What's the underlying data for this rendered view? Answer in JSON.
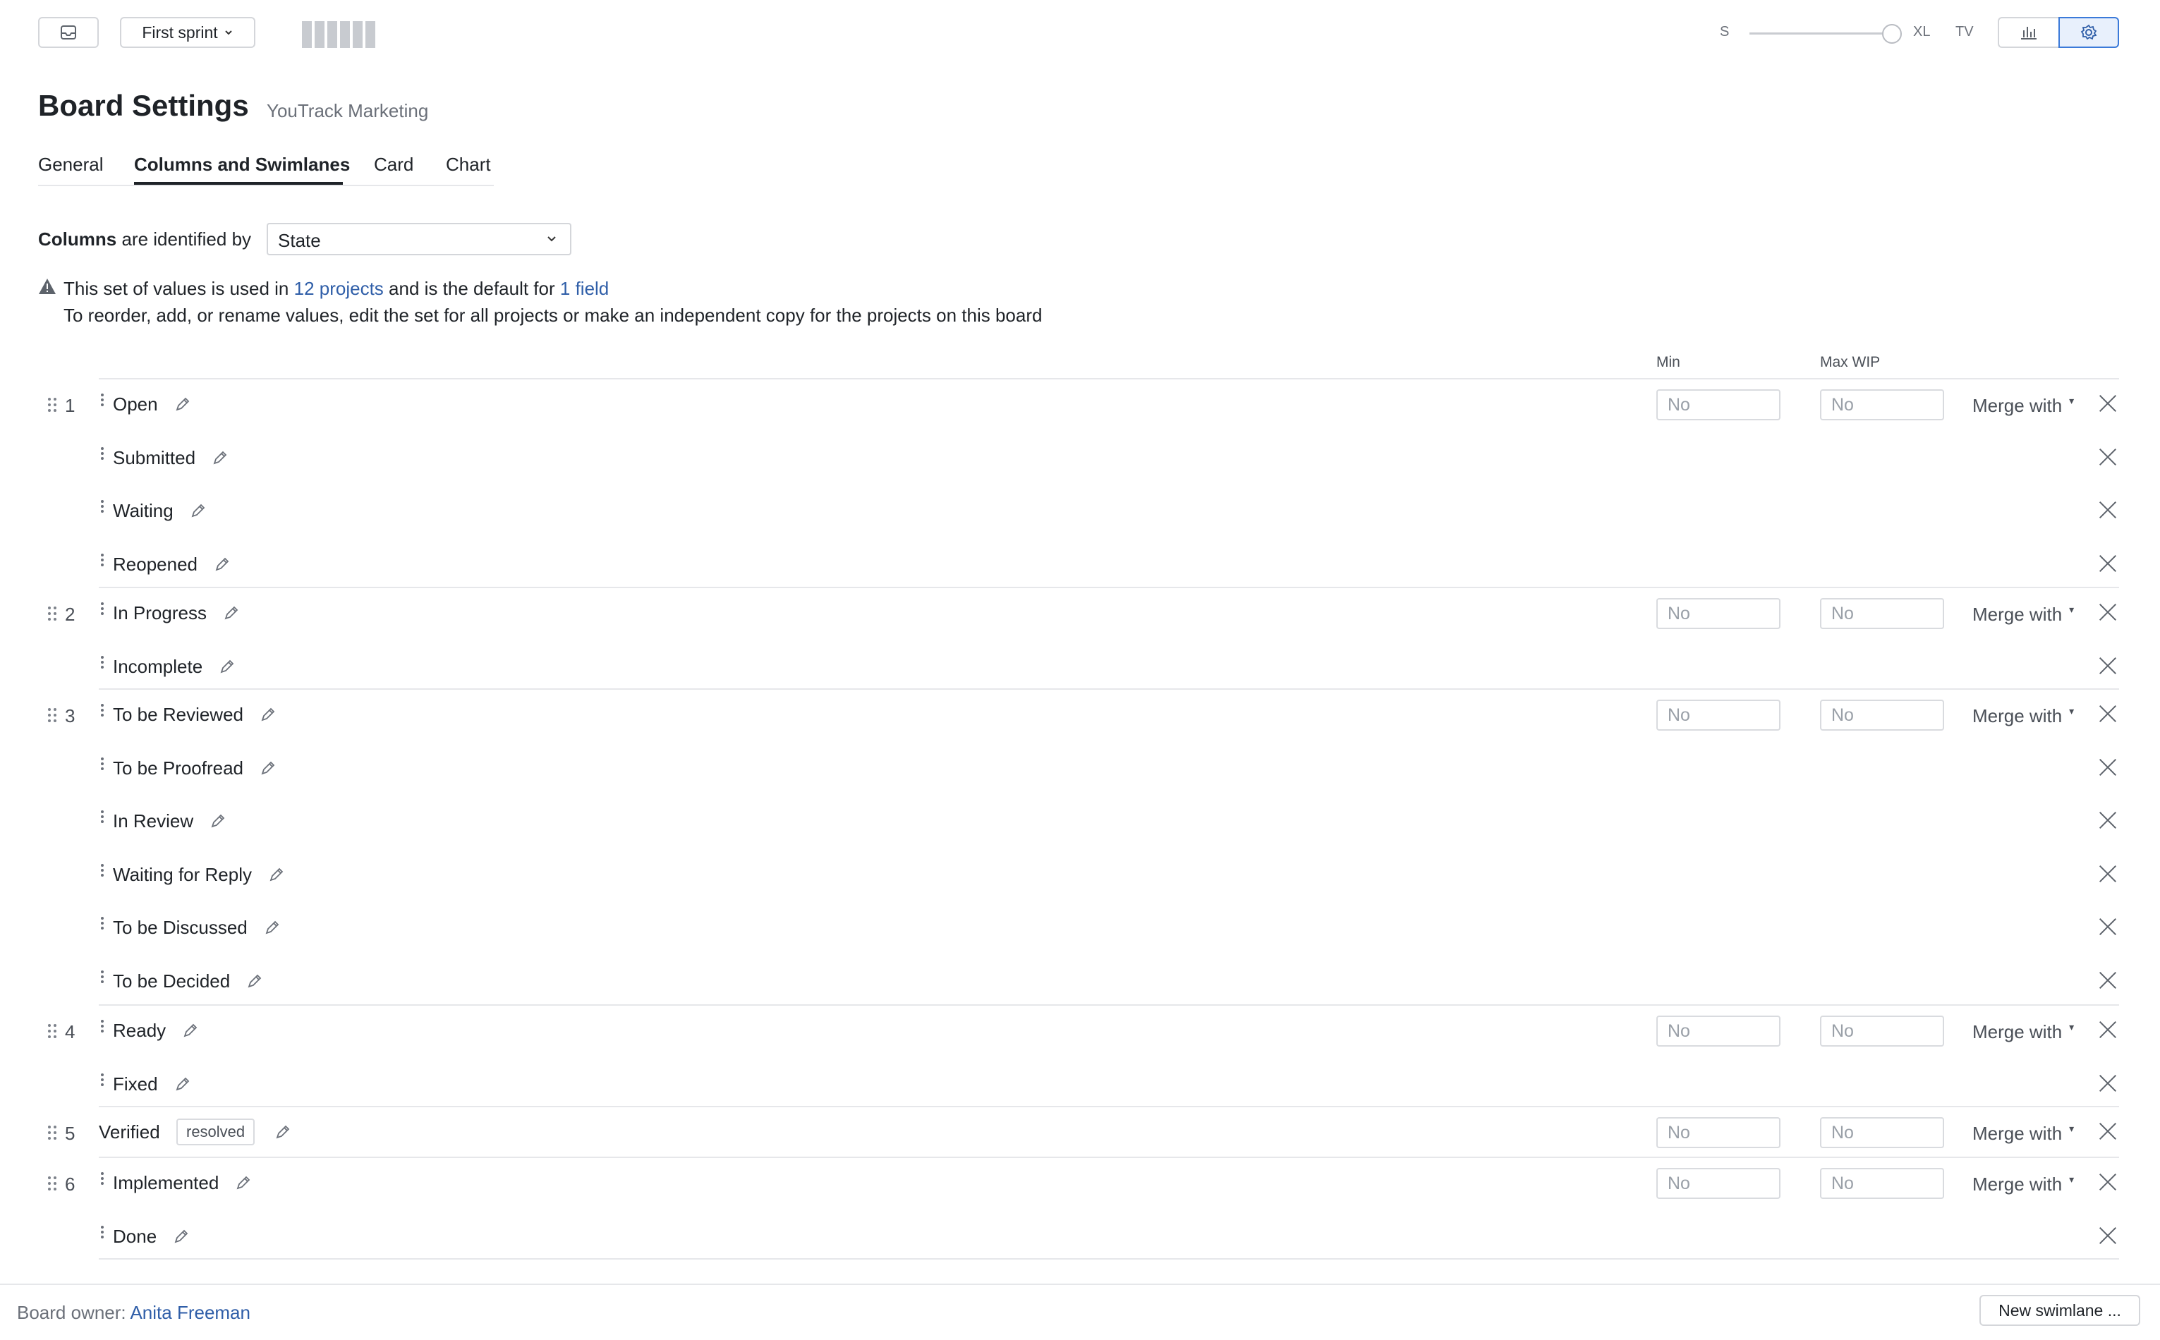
{
  "toolbar": {
    "sprint_label": "First sprint",
    "size_min": "S",
    "size_max": "XL",
    "tv_label": "TV",
    "size_level": 1.0
  },
  "header": {
    "title": "Board Settings",
    "project": "YouTrack Marketing"
  },
  "tabs": [
    "General",
    "Columns and Swimlanes",
    "Card",
    "Chart"
  ],
  "columns_by": {
    "label_bold": "Columns",
    "label_rest": "are identified by",
    "value": "State"
  },
  "notice": {
    "line1_a": "This set of values is used in",
    "projects_link": "12 projects",
    "line1_b": "and is the default for",
    "field_link": "1 field",
    "line2": "To reorder, add, or rename values, edit the set for all projects or make an independent copy for the projects on this board"
  },
  "headers": {
    "min": "Min",
    "max_wip": "Max WIP"
  },
  "placeholder": "No",
  "merge_label": "Merge with",
  "resolved_badge": "resolved",
  "groups": [
    {
      "num": "1",
      "values": [
        "Open",
        "Submitted",
        "Waiting",
        "Reopened"
      ]
    },
    {
      "num": "2",
      "values": [
        "In Progress",
        "Incomplete"
      ]
    },
    {
      "num": "3",
      "values": [
        "To be Reviewed",
        "To be Proofread",
        "In Review",
        "Waiting for Reply",
        "To be Discussed",
        "To be Decided"
      ]
    },
    {
      "num": "4",
      "values": [
        "Ready",
        "Fixed"
      ]
    },
    {
      "num": "5",
      "values": [
        "Verified"
      ]
    },
    {
      "num": "6",
      "values": [
        "Implemented",
        "Done"
      ]
    }
  ],
  "footer": {
    "owner_label": "Board owner:",
    "owner_name": "Anita Freeman",
    "new_swimlane": "New swimlane ..."
  }
}
